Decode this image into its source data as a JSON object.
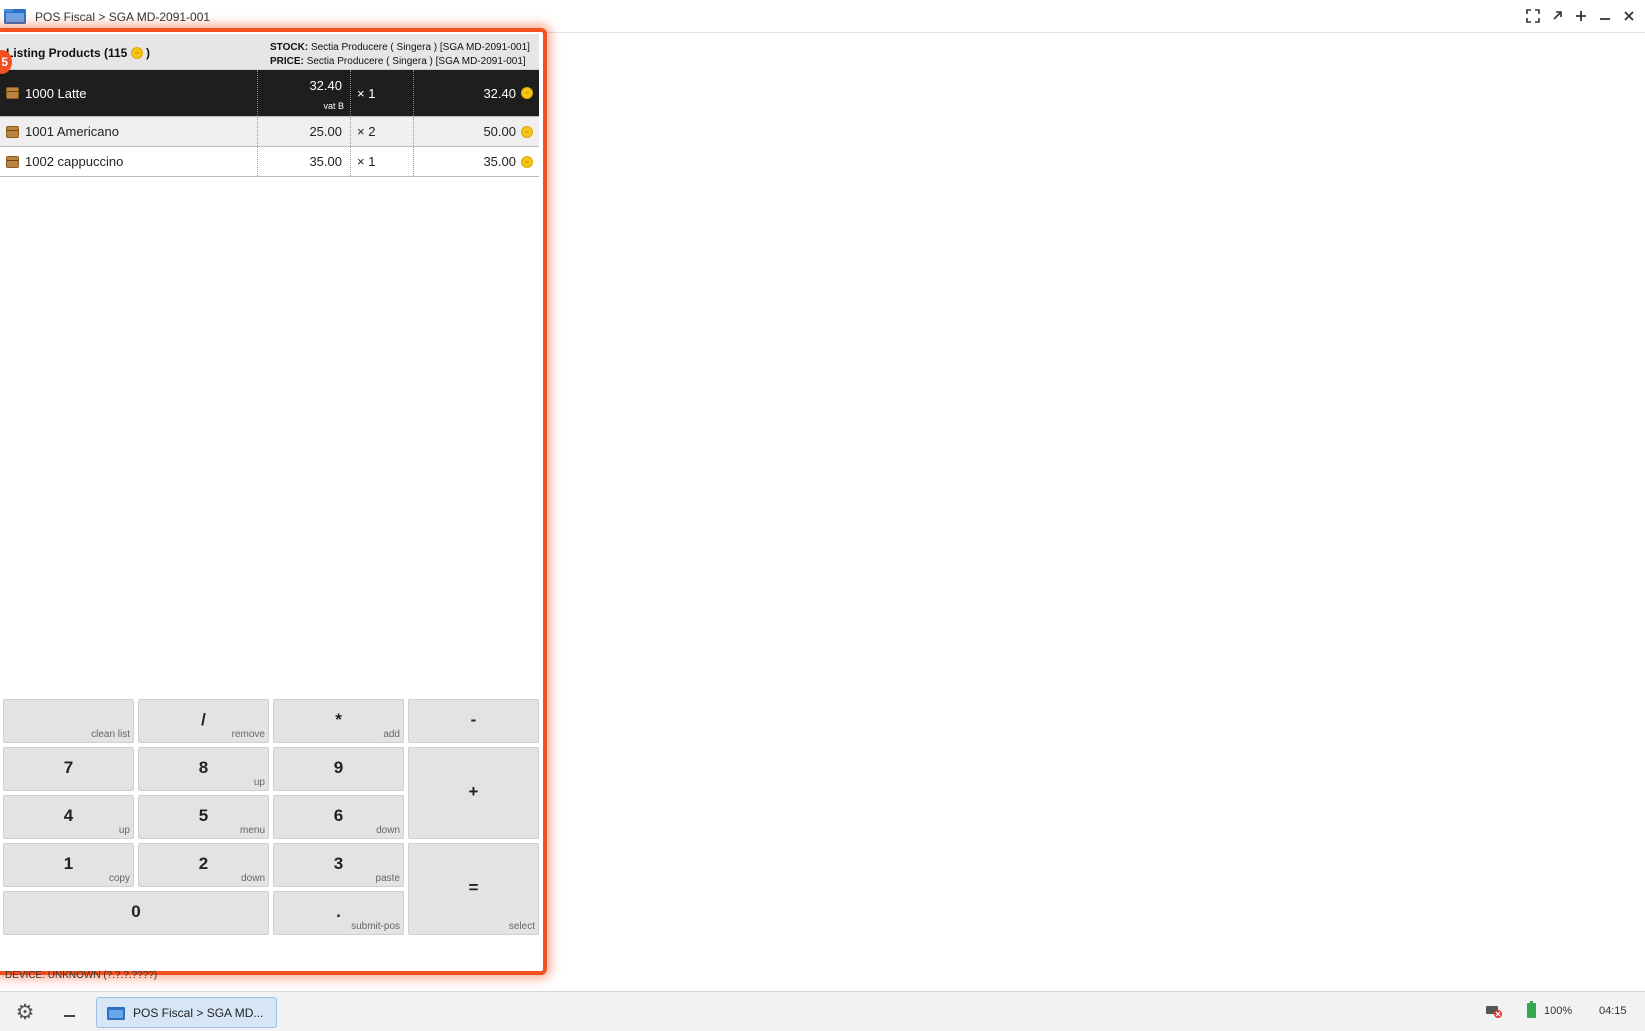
{
  "window": {
    "title": "POS Fiscal > SGA MD-2091-001",
    "controls": [
      "fullscreen-icon",
      "restore-icon",
      "add-icon",
      "minimize-icon",
      "close-icon"
    ]
  },
  "pos": {
    "badge": "5",
    "listing_title": "Listing Products (115",
    "listing_close": ")",
    "stock_label": "STOCK:",
    "stock_value": "Sectia Producere ( Singera ) [SGA MD-2091-001]",
    "price_label": "PRICE:",
    "price_value": "Sectia Producere ( Singera ) [SGA MD-2091-001]",
    "products": [
      {
        "name": "1000 Latte",
        "price": "32.40",
        "vat": "vat B",
        "qty": "× 1",
        "total": "32.40",
        "selected": true
      },
      {
        "name": "1001 Americano",
        "price": "25.00",
        "vat": "",
        "qty": "× 2",
        "total": "50.00",
        "selected": false
      },
      {
        "name": "1002 cappuccino",
        "price": "35.00",
        "vat": "",
        "qty": "× 1",
        "total": "35.00",
        "selected": false
      }
    ],
    "keypad": {
      "clean": {
        "main": "",
        "sub": "clean list"
      },
      "div": {
        "main": "/",
        "sub": "remove"
      },
      "mul": {
        "main": "*",
        "sub": "add"
      },
      "minus": {
        "main": "-",
        "sub": ""
      },
      "k7": {
        "main": "7",
        "sub": ""
      },
      "k8": {
        "main": "8",
        "sub": "up"
      },
      "k9": {
        "main": "9",
        "sub": ""
      },
      "plus": {
        "main": "+",
        "sub": ""
      },
      "k4": {
        "main": "4",
        "sub": "up"
      },
      "k5": {
        "main": "5",
        "sub": "menu"
      },
      "k6": {
        "main": "6",
        "sub": "down"
      },
      "k1": {
        "main": "1",
        "sub": "copy"
      },
      "k2": {
        "main": "2",
        "sub": "down"
      },
      "k3": {
        "main": "3",
        "sub": "paste"
      },
      "eq": {
        "main": "=",
        "sub": "select"
      },
      "k0": {
        "main": "0",
        "sub": ""
      },
      "dot": {
        "main": ".",
        "sub": "submit-pos"
      }
    },
    "device_status": "DEVICE: UNKNOWN (?.?.?.????)"
  },
  "taskbar": {
    "task_label": "POS Fiscal > SGA MD...",
    "battery": "100%",
    "clock": "04:15"
  },
  "colors": {
    "accent": "#f4511e",
    "selected_row": "#1e1e1e",
    "coin": "#f5c518",
    "battery": "#36a852"
  }
}
